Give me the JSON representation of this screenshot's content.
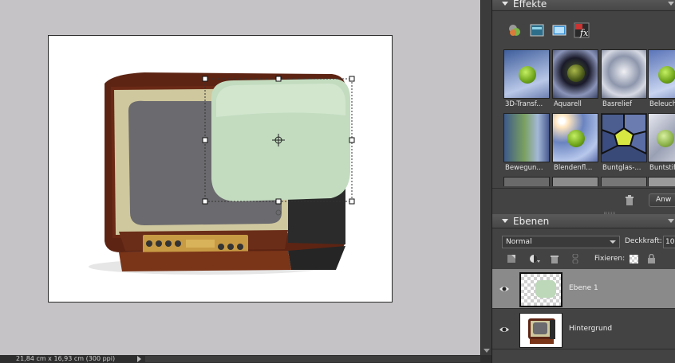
{
  "statusbar": {
    "doc_size": "21,84 cm x 16,93 cm (300 ppi)"
  },
  "effects": {
    "title": "Effekte",
    "toolbar_icons": [
      "layer-styles-icon",
      "photo-effects-icon",
      "filters-icon",
      "fx-all-icon"
    ],
    "thumbnails": [
      {
        "label": "3D-Transf...",
        "style": "transform"
      },
      {
        "label": "Aquarell",
        "style": "watercolor"
      },
      {
        "label": "Basrelief",
        "style": "basrelief"
      },
      {
        "label": "Beleuch",
        "style": "lighting"
      },
      {
        "label": "Bewegun...",
        "style": "motion"
      },
      {
        "label": "Blendenfl...",
        "style": "flare"
      },
      {
        "label": "Buntglas-...",
        "style": "stainedglass"
      },
      {
        "label": "Buntstif",
        "style": "pencil"
      }
    ],
    "apply_label": "Anw"
  },
  "layers": {
    "title": "Ebenen",
    "blend_mode": "Normal",
    "opacity_label": "Deckkraft:",
    "opacity_value": "10",
    "lock_label": "Fixieren:",
    "rows": [
      {
        "name": "Ebene 1",
        "selected": true,
        "visible": true
      },
      {
        "name": "Hintergrund",
        "selected": false,
        "visible": true
      }
    ]
  },
  "colors": {
    "panel_bg": "#434343",
    "selection": "#8a8a8a",
    "canvas_bg": "#c5c3c5"
  }
}
